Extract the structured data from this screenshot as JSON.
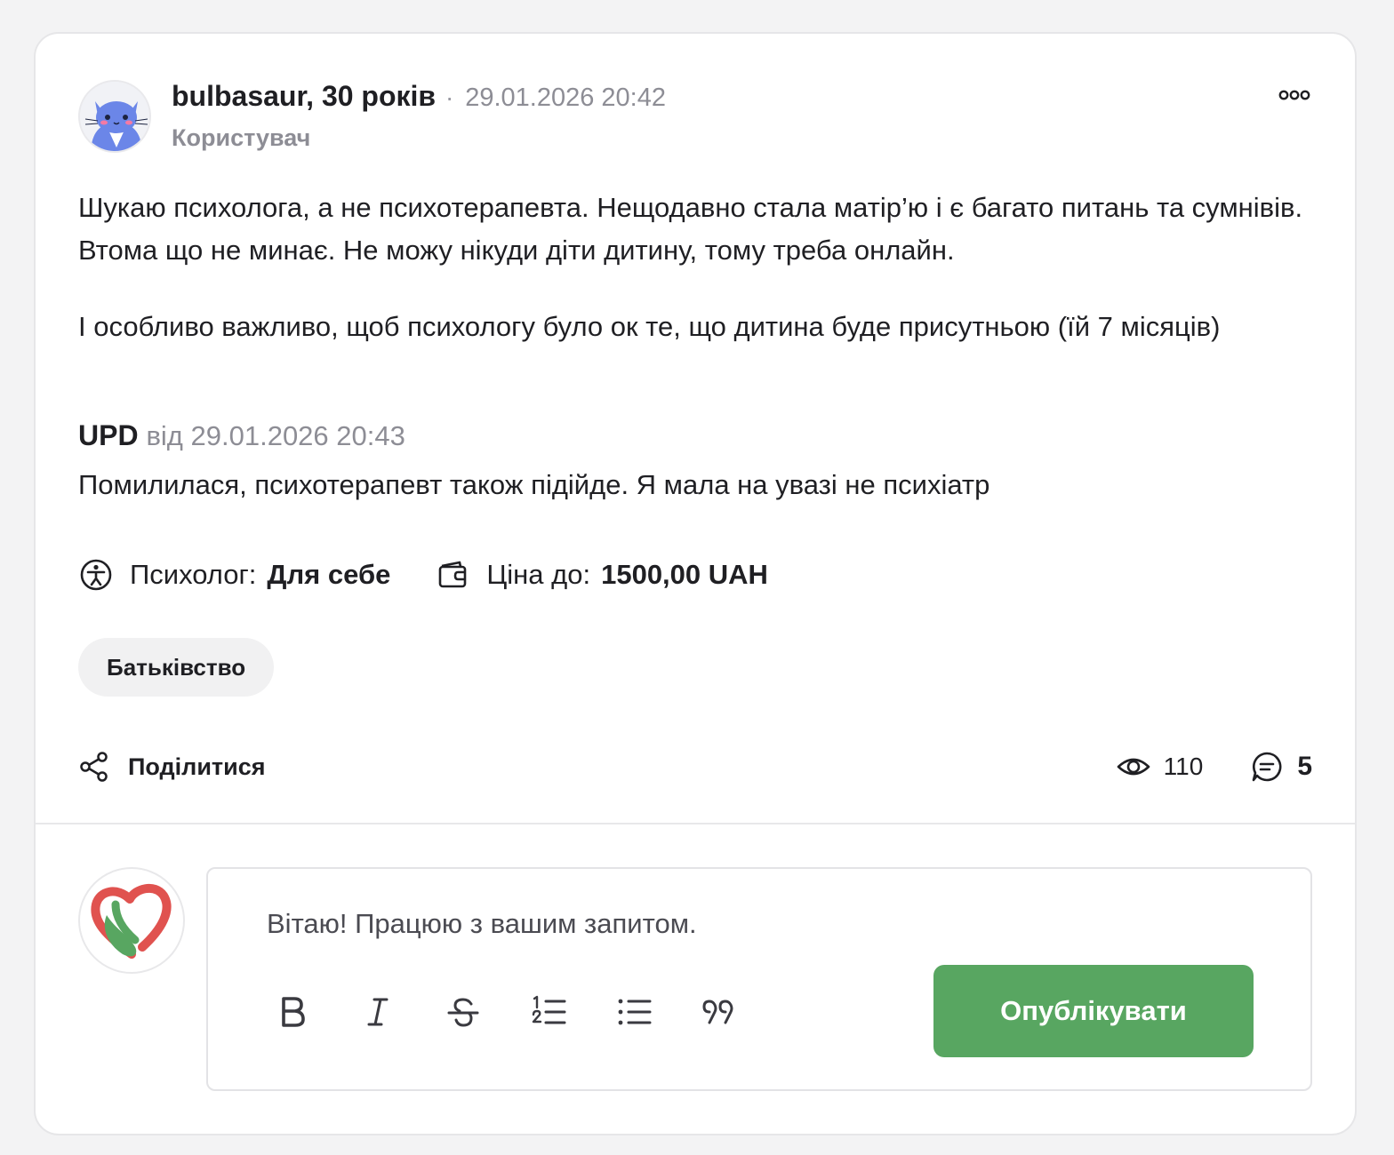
{
  "post": {
    "author": {
      "name": "bulbasaur, 30 років",
      "separator": "·",
      "date": "29.01.2026 20:42",
      "role": "Користувач",
      "avatar_icon": "cat-avatar-icon"
    },
    "more_icon": "more-options-icon",
    "body": [
      "Шукаю психолога, а не психотерапевта. Нещодавно стала матір’ю і є багато питань та сумнівів. Втома що не минає. Не можу нікуди діти дитину, тому треба онлайн.",
      "І особливо важливо, щоб психологу було ок те, що дитина буде присутньою (їй 7 місяців)"
    ],
    "update": {
      "label": "UPD",
      "date_text": "від 29.01.2026 20:43",
      "text": "Помилилася, психотерапевт також підійде. Я мала на увазі не психіатр"
    },
    "meta": {
      "psychologist_label": "Психолог:",
      "psychologist_value": "Для себе",
      "price_label": "Ціна до:",
      "price_value": "1500,00 UAH"
    },
    "tag": "Батьківство",
    "share_label": "Поділитися",
    "stats": {
      "views": "110",
      "comments": "5"
    }
  },
  "reply": {
    "avatar_icon": "heart-hand-logo-icon",
    "text": "Вітаю! Працюю з вашим запитом.",
    "toolbar": [
      "bold",
      "italic",
      "strikethrough",
      "ordered-list",
      "bullet-list",
      "quote"
    ],
    "publish_label": "Опублікувати"
  },
  "colors": {
    "accent": "#58a661",
    "muted_text": "#8d8d95",
    "tag_bg": "#f1f1f2",
    "logo_red": "#e0524f",
    "logo_green": "#58a661"
  }
}
